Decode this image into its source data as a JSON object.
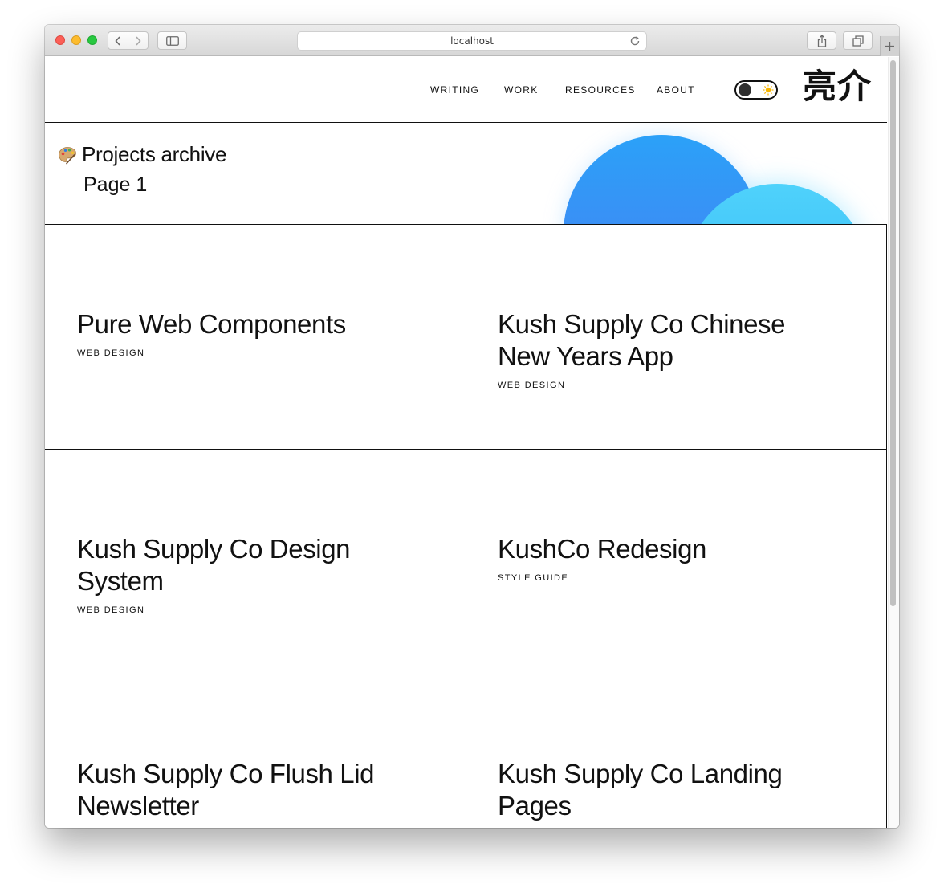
{
  "browser": {
    "url": "localhost"
  },
  "nav": {
    "items": [
      {
        "label": "WRITING"
      },
      {
        "label": "WORK"
      },
      {
        "label": "RESOURCES"
      },
      {
        "label": "ABOUT"
      }
    ],
    "logo": "亮介",
    "theme_toggle": "light"
  },
  "hero": {
    "icon": "palette-icon",
    "title": "Projects archive",
    "subtitle": "Page 1",
    "colors": {
      "circle_primary": "#2b8ff7",
      "circle_secondary": "#38c6fb"
    }
  },
  "projects": [
    {
      "title": "Pure Web Components",
      "tag": "WEB DESIGN"
    },
    {
      "title": "Kush Supply Co Chinese New Years App",
      "tag": "WEB DESIGN"
    },
    {
      "title": "Kush Supply Co Design System",
      "tag": "WEB DESIGN"
    },
    {
      "title": "KushCo Redesign",
      "tag": "STYLE GUIDE"
    },
    {
      "title": "Kush Supply Co Flush Lid Newsletter",
      "tag": ""
    },
    {
      "title": "Kush Supply Co Landing Pages",
      "tag": ""
    }
  ]
}
